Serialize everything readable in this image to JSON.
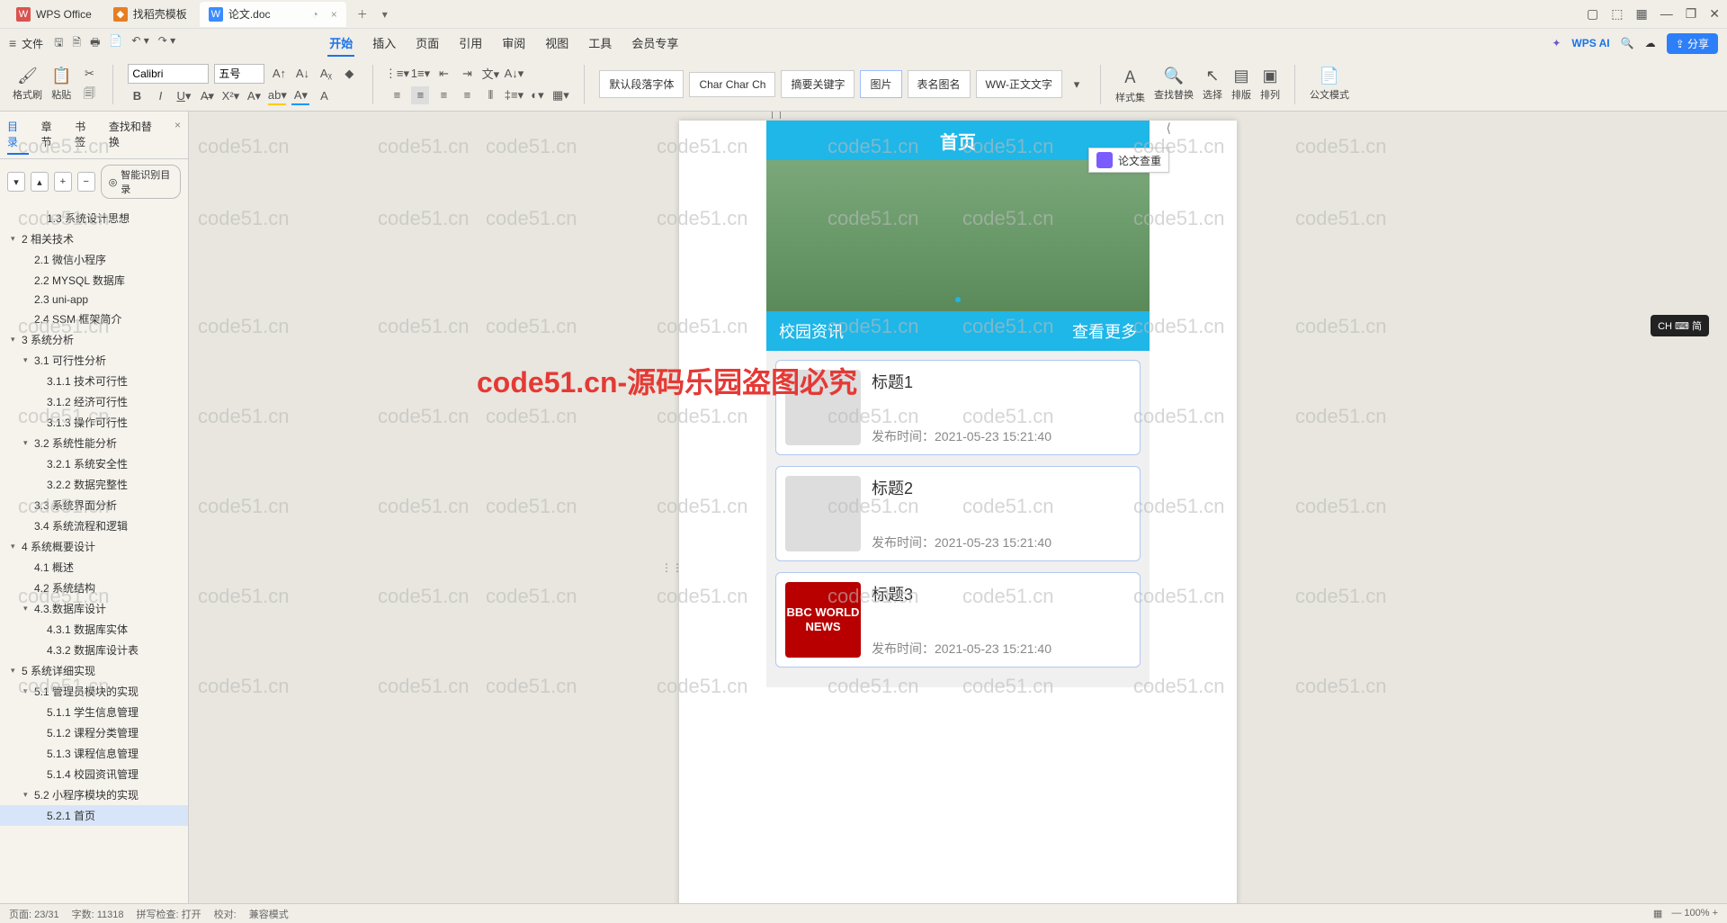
{
  "tabs": [
    {
      "label": "WPS Office",
      "icon": "red"
    },
    {
      "label": "找稻壳模板",
      "icon": "orange"
    },
    {
      "label": "论文.doc",
      "icon": "blue",
      "active": true
    }
  ],
  "menubar": {
    "file": "文件"
  },
  "qat_icons": [
    "save",
    "print-preview",
    "print",
    "export",
    "undo",
    "redo"
  ],
  "ribbon_tabs": [
    "开始",
    "插入",
    "页面",
    "引用",
    "审阅",
    "视图",
    "工具",
    "会员专享"
  ],
  "ribbon_active": "开始",
  "ai": "WPS AI",
  "share": "分享",
  "ribbon": {
    "format_painter": "格式刷",
    "paste": "粘贴",
    "font": "Calibri",
    "size": "五号",
    "default_para": "默认段落字体",
    "char_style": "Char Char Ch",
    "abstract": "摘要关键字",
    "image": "图片",
    "table_name": "表名图名",
    "body": "WW-正文文字",
    "styles": "样式集",
    "find": "查找替换",
    "select": "选择",
    "sort": "排版",
    "arrange": "排列",
    "official": "公文模式"
  },
  "nav": {
    "tabs": [
      "目录",
      "章节",
      "书签",
      "查找和替换"
    ],
    "active": "目录",
    "smart": "智能识别目录",
    "items": [
      {
        "t": "1.3 系统设计思想",
        "d": 2
      },
      {
        "t": "2 相关技术",
        "d": 0,
        "a": true
      },
      {
        "t": "2.1 微信小程序",
        "d": 1
      },
      {
        "t": "2.2 MYSQL 数据库",
        "d": 1
      },
      {
        "t": "2.3 uni-app",
        "d": 1
      },
      {
        "t": "2.4 SSM 框架简介",
        "d": 1
      },
      {
        "t": "3 系统分析",
        "d": 0,
        "a": true
      },
      {
        "t": "3.1 可行性分析",
        "d": 1,
        "a": true
      },
      {
        "t": "3.1.1 技术可行性",
        "d": 2
      },
      {
        "t": "3.1.2 经济可行性",
        "d": 2
      },
      {
        "t": "3.1.3 操作可行性",
        "d": 2
      },
      {
        "t": "3.2 系统性能分析",
        "d": 1,
        "a": true
      },
      {
        "t": "3.2.1  系统安全性",
        "d": 2
      },
      {
        "t": "3.2.2 数据完整性",
        "d": 2
      },
      {
        "t": "3.3 系统界面分析",
        "d": 1
      },
      {
        "t": "3.4 系统流程和逻辑",
        "d": 1
      },
      {
        "t": "4 系统概要设计",
        "d": 0,
        "a": true
      },
      {
        "t": "4.1 概述",
        "d": 1
      },
      {
        "t": "4.2 系统结构",
        "d": 1
      },
      {
        "t": "4.3.数据库设计",
        "d": 1,
        "a": true
      },
      {
        "t": "4.3.1 数据库实体",
        "d": 2
      },
      {
        "t": "4.3.2 数据库设计表",
        "d": 2
      },
      {
        "t": "5 系统详细实现",
        "d": 0,
        "a": true
      },
      {
        "t": "5.1 管理员模块的实现",
        "d": 1,
        "a": true
      },
      {
        "t": "5.1.1 学生信息管理",
        "d": 2
      },
      {
        "t": "5.1.2 课程分类管理",
        "d": 2
      },
      {
        "t": "5.1.3 课程信息管理",
        "d": 2
      },
      {
        "t": "5.1.4 校园资讯管理",
        "d": 2
      },
      {
        "t": "5.2 小程序模块的实现",
        "d": 1,
        "a": true
      },
      {
        "t": "5.2.1 首页",
        "d": 2,
        "sel": true
      }
    ]
  },
  "doc": {
    "phone_title": "首页",
    "section": "校园资讯",
    "more": "查看更多",
    "news": [
      {
        "title": "标题1",
        "time": "发布时间：2021-05-23 15:21:40",
        "thumb": "news"
      },
      {
        "title": "标题2",
        "time": "发布时间：2021-05-23 15:21:40",
        "thumb": "photo"
      },
      {
        "title": "标题3",
        "time": "发布时间：2021-05-23 15:21:40",
        "thumb": "bbc",
        "thumb_text": "BBC\nWORLD\nNEWS"
      }
    ]
  },
  "float": {
    "thesis_check": "论文查重"
  },
  "ime": "CH ⌨ 简",
  "status": {
    "page": "页面: 23/31",
    "words": "字数: 11318",
    "check": "拼写检查: 打开",
    "proofread": "校对:",
    "mode": "兼容模式"
  },
  "watermark": "code51.cn",
  "watermark_red": "code51.cn-源码乐园盗图必究"
}
